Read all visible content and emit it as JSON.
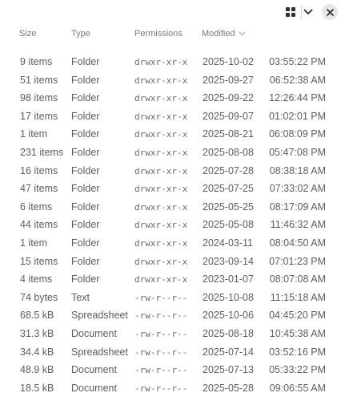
{
  "toolbar": {
    "view_icon": "grid-view-icon",
    "menu_icon": "chevron-down-icon",
    "close_icon": "close-icon"
  },
  "columns": {
    "size": "Size",
    "type": "Type",
    "permissions": "Permissions",
    "modified": "Modified"
  },
  "rows": [
    {
      "size": "9 items",
      "type": "Folder",
      "permissions": "drwxr-xr-x",
      "date": "2025-10-02",
      "time": "03:55:22 PM"
    },
    {
      "size": "51 items",
      "type": "Folder",
      "permissions": "drwxr-xr-x",
      "date": "2025-09-27",
      "time": "06:52:38 AM"
    },
    {
      "size": "98 items",
      "type": "Folder",
      "permissions": "drwxr-xr-x",
      "date": "2025-09-22",
      "time": "12:26:44 PM"
    },
    {
      "size": "17 items",
      "type": "Folder",
      "permissions": "drwxr-xr-x",
      "date": "2025-09-07",
      "time": "01:02:01 PM"
    },
    {
      "size": "1 item",
      "type": "Folder",
      "permissions": "drwxr-xr-x",
      "date": "2025-08-21",
      "time": "06:08:09 PM"
    },
    {
      "size": "231 items",
      "type": "Folder",
      "permissions": "drwxr-xr-x",
      "date": "2025-08-08",
      "time": "05:47:08 PM"
    },
    {
      "size": "16 items",
      "type": "Folder",
      "permissions": "drwxr-xr-x",
      "date": "2025-07-28",
      "time": "08:38:18 AM"
    },
    {
      "size": "47 items",
      "type": "Folder",
      "permissions": "drwxr-xr-x",
      "date": "2025-07-25",
      "time": "07:33:02 AM"
    },
    {
      "size": "6 items",
      "type": "Folder",
      "permissions": "drwxr-xr-x",
      "date": "2025-05-25",
      "time": "08:17:09 AM"
    },
    {
      "size": "44 items",
      "type": "Folder",
      "permissions": "drwxr-xr-x",
      "date": "2025-05-08",
      "time": "11:46:32 AM"
    },
    {
      "size": "1 item",
      "type": "Folder",
      "permissions": "drwxr-xr-x",
      "date": "2024-03-11",
      "time": "08:04:50 AM"
    },
    {
      "size": "15 items",
      "type": "Folder",
      "permissions": "drwxr-xr-x",
      "date": "2023-09-14",
      "time": "07:01:23 PM"
    },
    {
      "size": "4 items",
      "type": "Folder",
      "permissions": "drwxr-xr-x",
      "date": "2023-01-07",
      "time": "08:07:08 AM"
    },
    {
      "size": "74 bytes",
      "type": "Text",
      "permissions": "-rw-r--r--",
      "date": "2025-10-08",
      "time": "11:15:18 AM"
    },
    {
      "size": "68.5 kB",
      "type": "Spreadsheet",
      "permissions": "-rw-r--r--",
      "date": "2025-10-06",
      "time": "04:45:20 PM"
    },
    {
      "size": "31.3 kB",
      "type": "Document",
      "permissions": "-rw-r--r--",
      "date": "2025-08-18",
      "time": "10:45:38 AM"
    },
    {
      "size": "34.4 kB",
      "type": "Spreadsheet",
      "permissions": "-rw-r--r--",
      "date": "2025-07-14",
      "time": "03:52:16 PM"
    },
    {
      "size": "48.9 kB",
      "type": "Document",
      "permissions": "-rw-r--r--",
      "date": "2025-07-13",
      "time": "05:33:22 PM"
    },
    {
      "size": "18.5 kB",
      "type": "Document",
      "permissions": "-rw-r--r--",
      "date": "2025-05-28",
      "time": "09:06:55 AM"
    }
  ]
}
